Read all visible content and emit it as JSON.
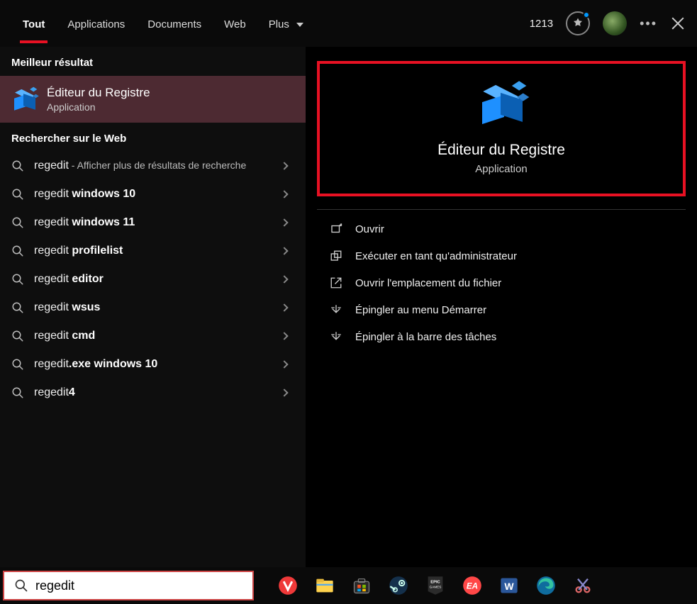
{
  "top": {
    "tabs": [
      "Tout",
      "Applications",
      "Documents",
      "Web",
      "Plus"
    ],
    "active_tab_index": 0,
    "points": "1213"
  },
  "left": {
    "best_header": "Meilleur résultat",
    "best_title": "Éditeur du Registre",
    "best_sub": "Application",
    "web_header": "Rechercher sur le Web",
    "web_items": [
      {
        "prefix": "regedit",
        "suffix": "",
        "desc": " - Afficher plus de résultats de recherche"
      },
      {
        "prefix": "regedit ",
        "suffix": "windows 10",
        "desc": ""
      },
      {
        "prefix": "regedit ",
        "suffix": "windows 11",
        "desc": ""
      },
      {
        "prefix": "regedit ",
        "suffix": "profilelist",
        "desc": ""
      },
      {
        "prefix": "regedit ",
        "suffix": "editor",
        "desc": ""
      },
      {
        "prefix": "regedit ",
        "suffix": "wsus",
        "desc": ""
      },
      {
        "prefix": "regedit ",
        "suffix": "cmd",
        "desc": ""
      },
      {
        "prefix": "regedit",
        "suffix": ".exe windows 10",
        "desc": ""
      },
      {
        "prefix": "regedit",
        "suffix": "4",
        "desc": ""
      }
    ]
  },
  "right": {
    "title": "Éditeur du Registre",
    "sub": "Application",
    "actions": [
      "Ouvrir",
      "Exécuter en tant qu'administrateur",
      "Ouvrir l'emplacement du fichier",
      "Épingler au menu Démarrer",
      "Épingler à la barre des tâches"
    ]
  },
  "search": {
    "value": "regedit"
  }
}
